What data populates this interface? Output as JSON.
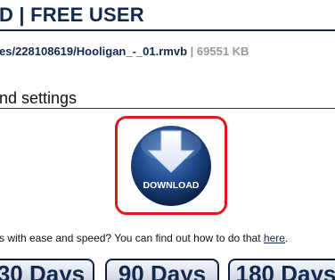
{
  "header": {
    "title": "D | FREE USER"
  },
  "file": {
    "path": "es/228108619/Hooligan_-_01.rmvb",
    "separator": "|",
    "size": "69551 KB"
  },
  "section": {
    "title": "nd settings"
  },
  "download_button": {
    "label": "DOWNLOAD",
    "frame_color": "#e0171d",
    "orb_color": "#1f4a8c"
  },
  "info": {
    "text": "s with ease and speed? You can find out how to do that ",
    "link": "here",
    "end": "."
  },
  "plans": [
    {
      "label": "30 Days"
    },
    {
      "label": "90 Days"
    },
    {
      "label": "180 Days"
    }
  ],
  "colors": {
    "brand": "#13294d",
    "muted": "#9a9a9a",
    "highlight": "#e0171d"
  }
}
